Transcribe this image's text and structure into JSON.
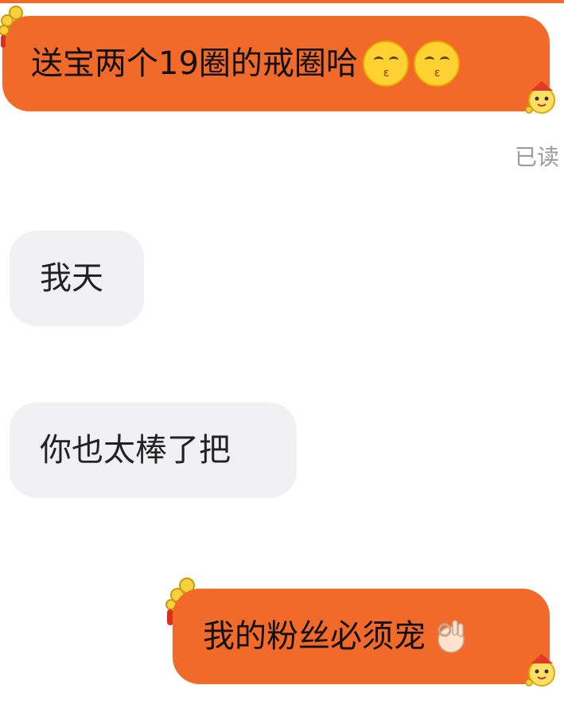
{
  "messages": [
    {
      "id": "m1",
      "direction": "outgoing",
      "text": "送宝两个19圈的戒圈哈",
      "emojis": [
        "kissing-face-icon",
        "kissing-face-icon"
      ]
    },
    {
      "id": "m2",
      "direction": "incoming",
      "text": "我天"
    },
    {
      "id": "m3",
      "direction": "incoming",
      "text": "你也太棒了把"
    },
    {
      "id": "m4",
      "direction": "outgoing",
      "text": "我的粉丝必须宠",
      "emojis": [
        "ok-hand-icon"
      ]
    }
  ],
  "read_status": "已读",
  "colors": {
    "outgoing_bubble": "#f26a2a",
    "incoming_bubble": "#f1f1f3",
    "top_bar": "#f26a2a",
    "read_status": "#9b9b9b"
  }
}
